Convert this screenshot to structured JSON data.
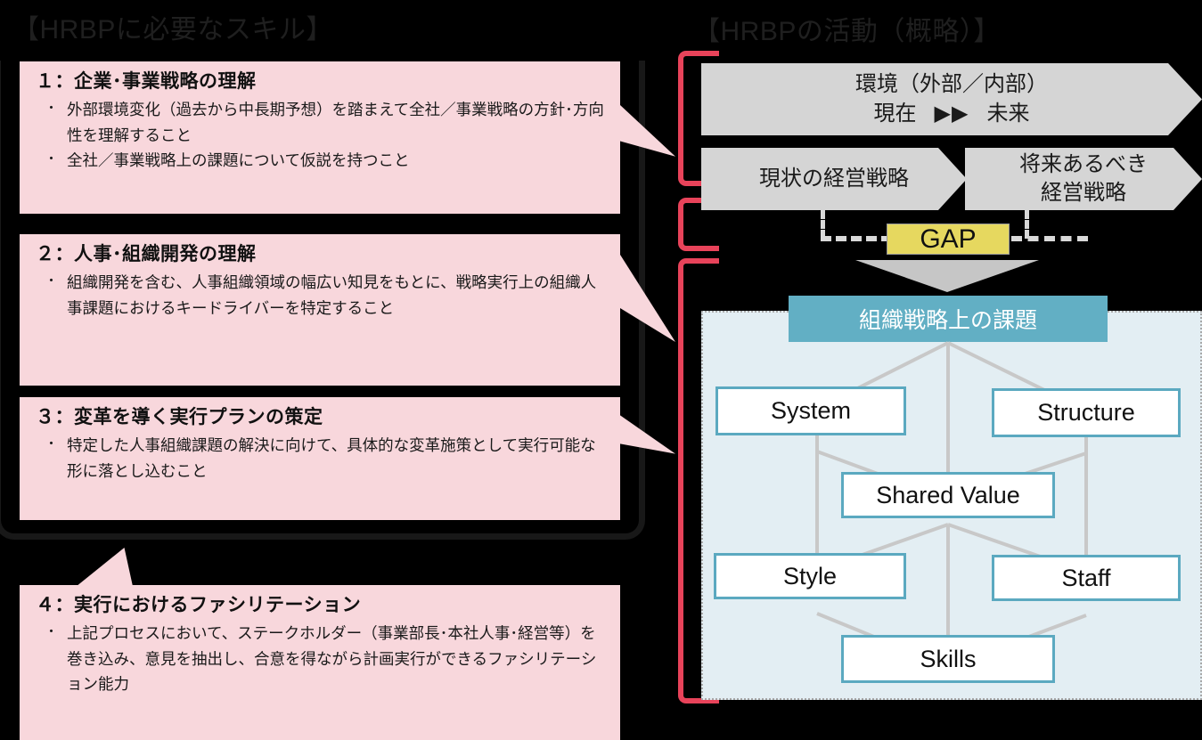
{
  "headings": {
    "left": "【HRBPに必要なスキル】",
    "right": "【HRBPの活動（概略）】"
  },
  "skills": [
    {
      "title": "１：企業･事業戦略の理解",
      "bullet": "・",
      "items": [
        "外部環境変化（過去から中長期予想）を踏まえて全社／事業戦略の方針･方向性を理解すること",
        "全社／事業戦略上の課題について仮説を持つこと"
      ]
    },
    {
      "title": "２：人事･組織開発の理解",
      "bullet": "・",
      "items": [
        "組織開発を含む、人事組織領域の幅広い知見をもとに、戦略実行上の組織人事課題におけるキードライバーを特定すること"
      ]
    },
    {
      "title": "３：変革を導く実行プランの策定",
      "bullet": "・",
      "items": [
        "特定した人事組織課題の解決に向けて、具体的な変革施策として実行可能な形に落とし込むこと"
      ]
    },
    {
      "title": "４：実行におけるファシリテーション",
      "bullet": "・",
      "items": [
        "上記プロセスにおいて、ステークホルダー（事業部長･本社人事･経営等）を巻き込み、意見を抽出し、合意を得ながら計画実行ができるファシリテーション能力"
      ]
    }
  ],
  "activity": {
    "environment": {
      "line1": "環境（外部／内部）",
      "line2_pre": "現在",
      "line2_arrows": "▶▶",
      "line2_post": "未来"
    },
    "current_strategy": "現状の経営戦略",
    "future_strategy_line1": "将来あるべき",
    "future_strategy_line2": "経営戦略",
    "gap_label": "GAP"
  },
  "seven_s": {
    "title": "組織戦略上の課題",
    "boxes": {
      "system": "System",
      "structure": "Structure",
      "shared_value": "Shared  Value",
      "style": "Style",
      "staff": "Staff",
      "skills": "Skills"
    }
  },
  "colors": {
    "pink": "#F8D7DC",
    "red_bracket": "#E8435A",
    "teal": "#62AFC4",
    "panel_blue": "#E3EEF3",
    "chevron_gray": "#D5D5D5",
    "gap_yellow": "#E6D85F"
  }
}
